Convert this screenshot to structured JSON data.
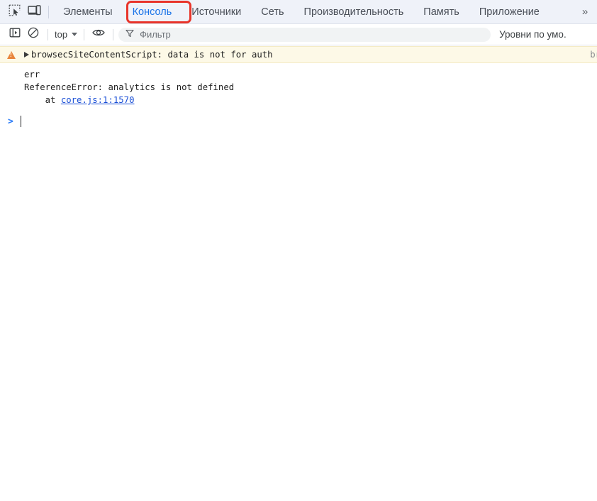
{
  "tabbar": {
    "inspect_icon": "inspect-element-icon",
    "device_icon": "device-toolbar-icon",
    "tabs": [
      {
        "label": "Элементы",
        "active": false
      },
      {
        "label": "Консоль",
        "active": true
      },
      {
        "label": "Источники",
        "active": false
      },
      {
        "label": "Сеть",
        "active": false
      },
      {
        "label": "Производительность",
        "active": false
      },
      {
        "label": "Память",
        "active": false
      },
      {
        "label": "Приложение",
        "active": false
      }
    ],
    "overflow_label": "»",
    "active_tab_highlight_color": "#e8342a",
    "active_tab_text_color": "#1a73e8"
  },
  "console_toolbar": {
    "sidebar_toggle_icon": "console-sidebar-icon",
    "clear_icon": "clear-console-icon",
    "context_value": "top",
    "eye_icon": "live-expression-icon",
    "filter_icon": "filter-icon",
    "filter_placeholder": "Фильтр",
    "filter_value": "",
    "levels_label": "Уровни по умо."
  },
  "console": {
    "warning_message": {
      "icon": "warning-icon",
      "expander": "disclosure-triangle-icon",
      "text": "browsecSiteContentScript: data is not for auth",
      "source": "br",
      "background_color": "#fdf9e7"
    },
    "stack": [
      "err",
      "ReferenceError: analytics is not defined",
      "    at "
    ],
    "stack_link": "core.js:1:1570",
    "prompt_symbol": ">"
  }
}
